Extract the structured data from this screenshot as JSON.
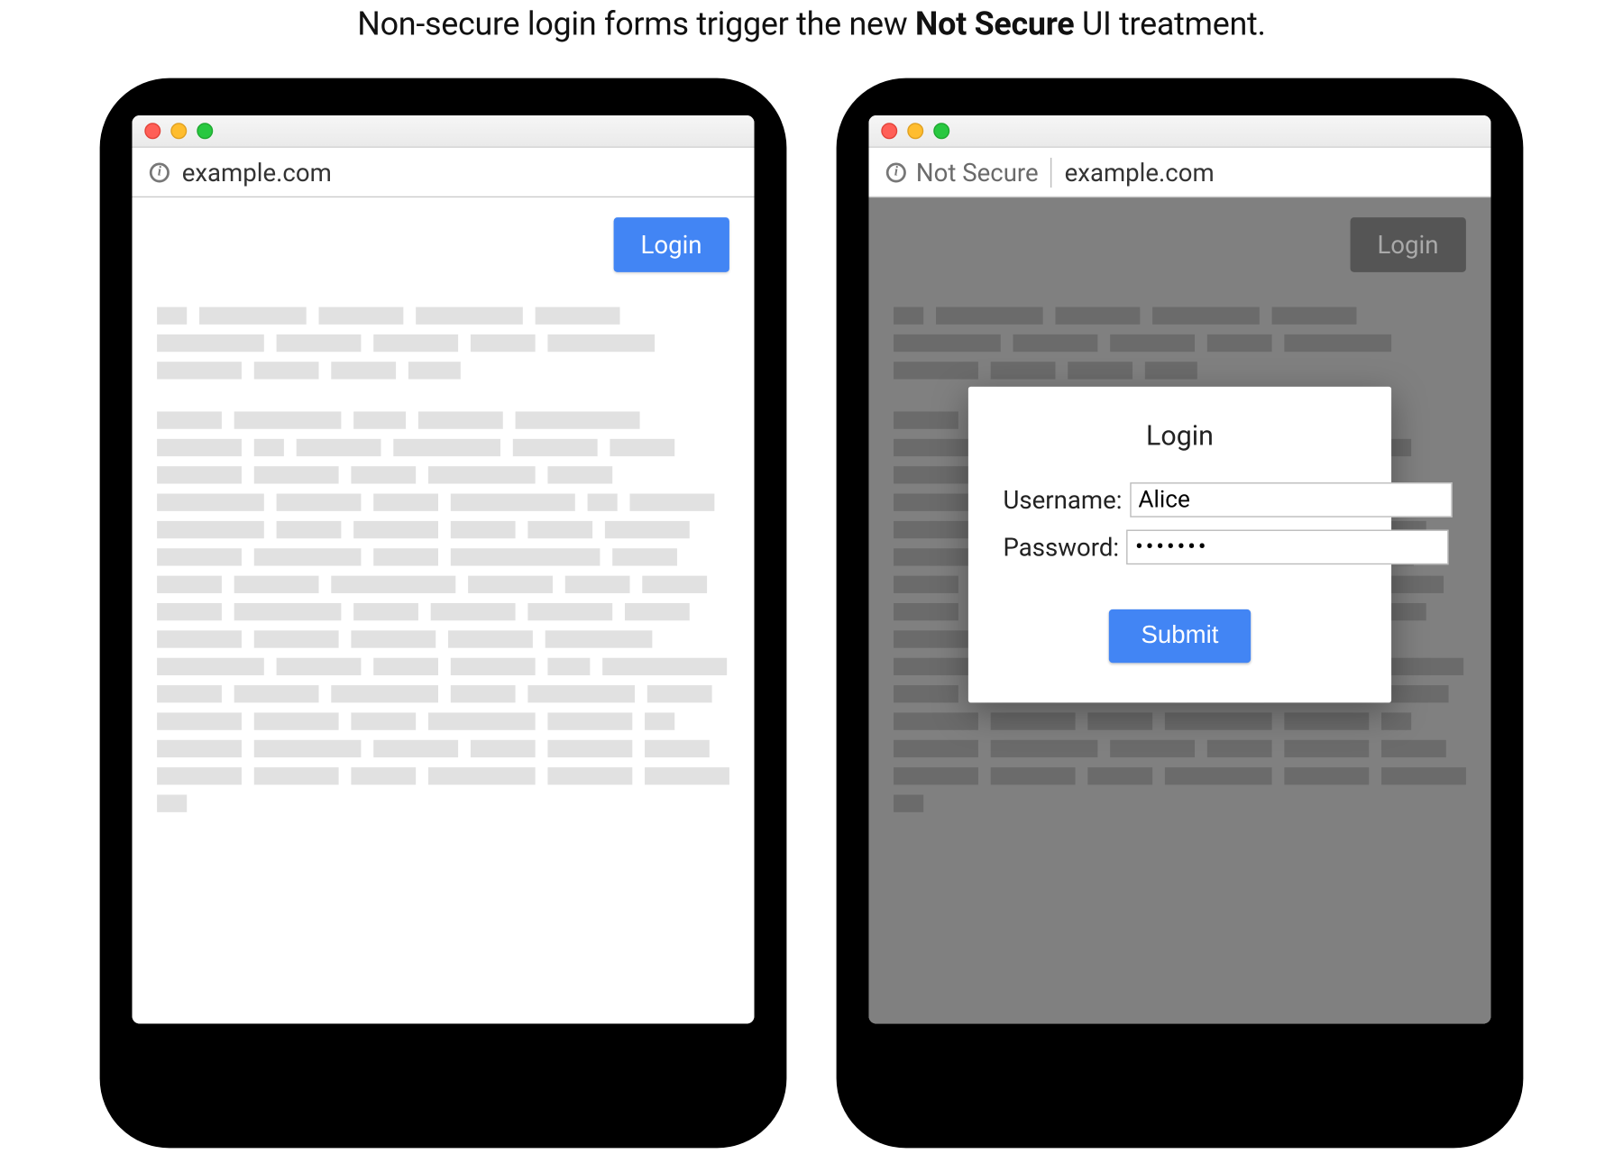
{
  "caption": {
    "prefix": "Non-secure login forms trigger the new ",
    "highlight": "Not Secure",
    "suffix": " UI treatment."
  },
  "left": {
    "url": "example.com",
    "login_button": "Login"
  },
  "right": {
    "not_secure_label": "Not Secure",
    "url": "example.com",
    "login_button": "Login",
    "modal": {
      "title": "Login",
      "username_label": "Username:",
      "username_value": "Alice",
      "password_label": "Password:",
      "password_value": "•••••••",
      "submit_label": "Submit"
    }
  },
  "colors": {
    "accent_blue": "#4285f4"
  }
}
